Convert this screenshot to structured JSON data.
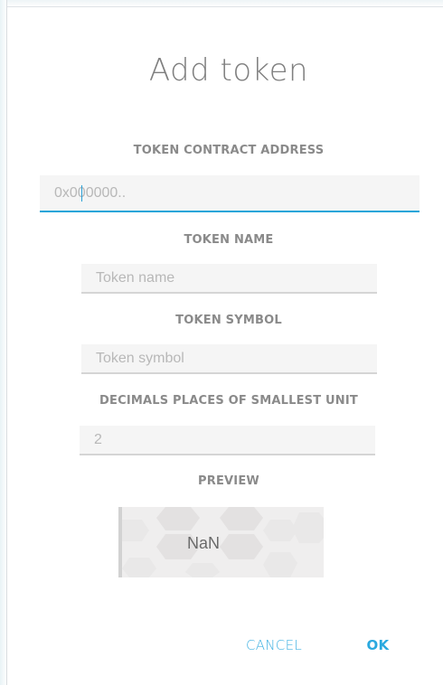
{
  "dialog": {
    "title": "Add token"
  },
  "fields": {
    "contract_address": {
      "label": "TOKEN CONTRACT ADDRESS",
      "value": "",
      "placeholder": "0x000000.."
    },
    "token_name": {
      "label": "TOKEN NAME",
      "value": "",
      "placeholder": "Token name"
    },
    "token_symbol": {
      "label": "TOKEN SYMBOL",
      "value": "",
      "placeholder": "Token symbol"
    },
    "decimals": {
      "label": "DECIMALS PLACES OF SMALLEST UNIT",
      "value": "",
      "placeholder": "2"
    }
  },
  "preview": {
    "label": "PREVIEW",
    "value": "NaN"
  },
  "actions": {
    "cancel_label": "CANCEL",
    "ok_label": "OK"
  },
  "colors": {
    "accent": "#2aa9df",
    "label": "#8a8a8a",
    "input_background": "#f5f5f5"
  }
}
